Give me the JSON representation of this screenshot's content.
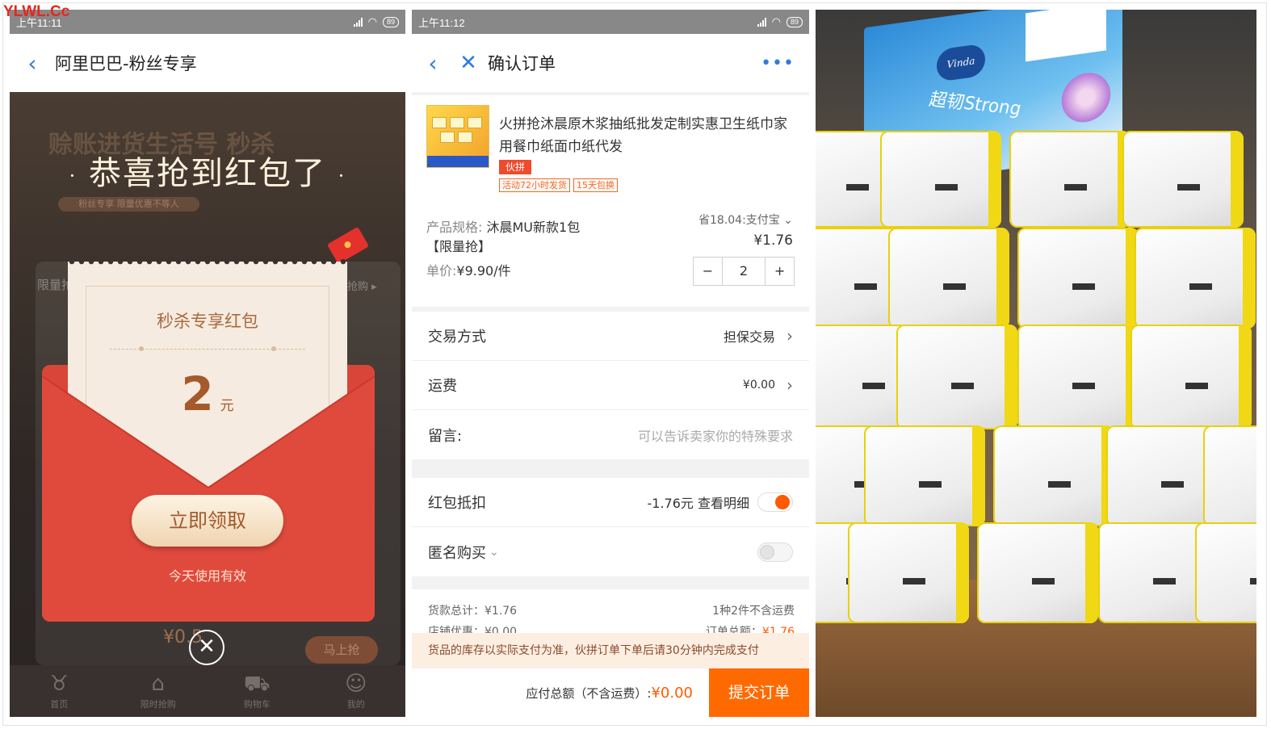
{
  "watermark": "YLWL.Cc",
  "panel1": {
    "status_time": "上午11:11",
    "battery": "89",
    "nav_title": "阿里巴巴-粉丝专享",
    "bg_headline": "赊账进货生活号 秒杀",
    "bg_subline": "粉丝专享 限量优惠不等人",
    "congrats": "恭喜抢到红包了",
    "bg_left_text": "限量抢",
    "bg_right_text": "抢购 ▸",
    "letter_title": "秒杀专享红包",
    "amount": "2",
    "amount_unit": "元",
    "claim_button": "立即领取",
    "valid_text": "今天使用有效",
    "bg_price": "¥0.5",
    "bg_button": "马上抢",
    "tabs": [
      {
        "icon": "cow-icon",
        "label": "首页"
      },
      {
        "icon": "home-icon",
        "label": "限时抢购"
      },
      {
        "icon": "cart-icon",
        "label": "购物车"
      },
      {
        "icon": "user-icon",
        "label": "我的"
      }
    ]
  },
  "panel2": {
    "status_time": "上午11:12",
    "battery": "89",
    "nav_title": "确认订单",
    "product_title": "火拼抢沐晨原木浆抽纸批发定制实惠卫生纸巾家用餐巾纸面巾纸代发",
    "pin_tag": "伙拼",
    "tags": [
      "活动72小时发货",
      "15天包换"
    ],
    "save_line": "省18.04:支付宝",
    "spec_label": "产品规格:",
    "spec_value": "沐晨MU新款1包",
    "spec_value2": "【限量抢】",
    "price": "¥1.76",
    "unit_label": "单价:",
    "unit_value": "¥9.90/件",
    "quantity": "2",
    "minus": "−",
    "plus": "+",
    "rows": {
      "trade_label": "交易方式",
      "trade_value": "担保交易",
      "freight_label": "运费",
      "freight_value": "¥0.00",
      "message_label": "留言:",
      "message_placeholder": "可以告诉卖家你的特殊要求"
    },
    "redpacket_label": "红包抵扣",
    "redpacket_value": "-1.76元 查看明细",
    "anonymous_label": "匿名购买",
    "summary": {
      "goods_total": "货款总计：¥1.76",
      "kinds": "1种2件不含运费",
      "shop_discount": "店铺优惠：¥0.00",
      "order_total_label": "订单总额：",
      "order_total": "¥1.76"
    },
    "notice": "货品的库存以实际支付为准，伙拼订单下单后请30分钟内完成支付",
    "payable_label": "应付总额（不含运费）:",
    "payable_amount": "¥0.00",
    "submit": "提交订单"
  },
  "panel3": {
    "brand": "Vinda",
    "brand_line": "超韧Strong"
  }
}
